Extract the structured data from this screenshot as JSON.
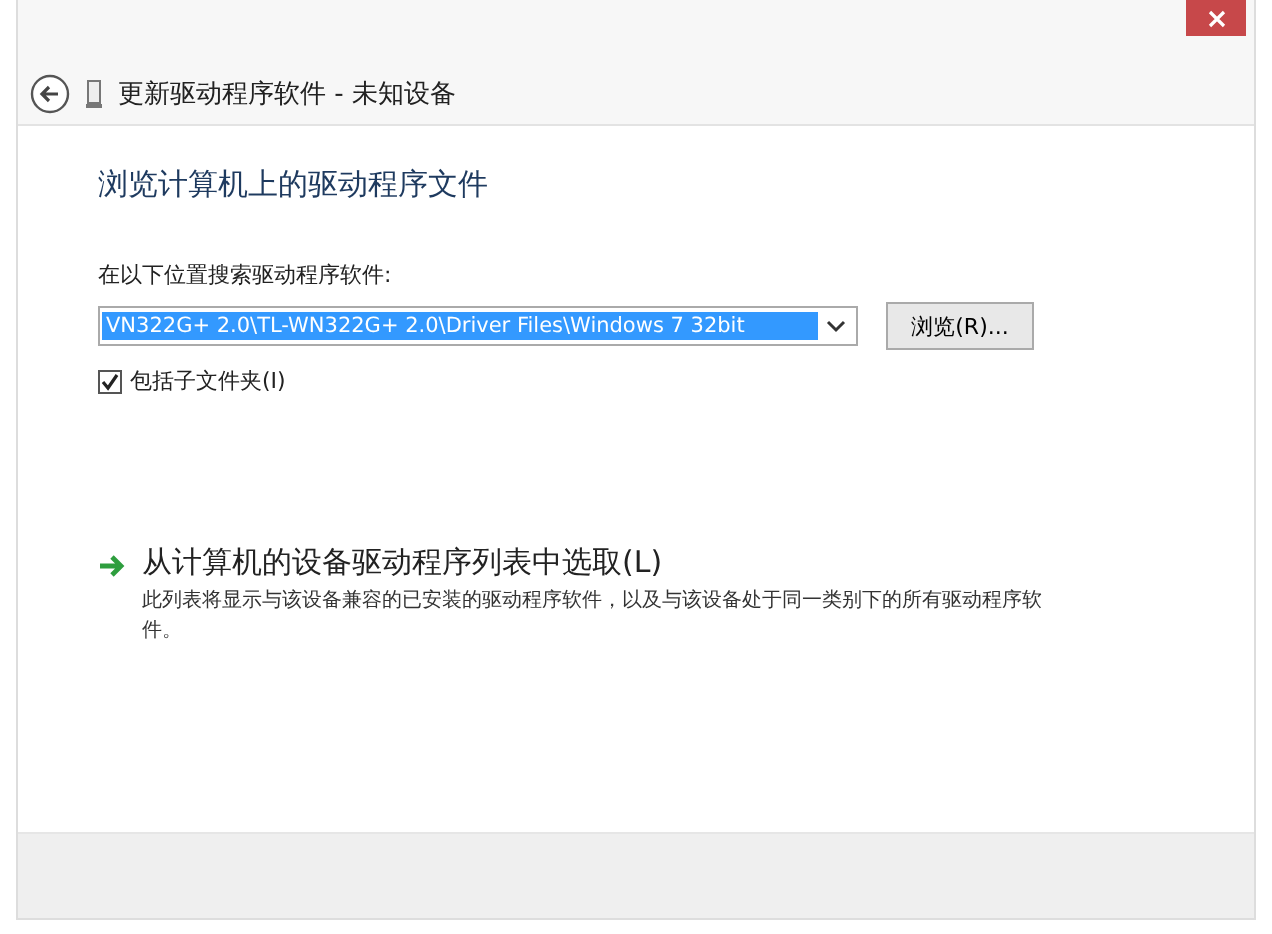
{
  "window": {
    "title": "更新驱动程序软件 - 未知设备"
  },
  "heading": "浏览计算机上的驱动程序文件",
  "location": {
    "label": "在以下位置搜索驱动程序软件:",
    "value": "VN322G+ 2.0\\TL-WN322G+ 2.0\\Driver Files\\Windows 7 32bit",
    "selected": true,
    "browse_button": "浏览(R)..."
  },
  "include_subfolders": {
    "label": "包括子文件夹(I)",
    "checked": true
  },
  "pick_from_list": {
    "title": "从计算机的设备驱动程序列表中选取(L)",
    "description": "此列表将显示与该设备兼容的已安装的驱动程序软件，以及与该设备处于同一类别下的所有驱动程序软件。"
  }
}
